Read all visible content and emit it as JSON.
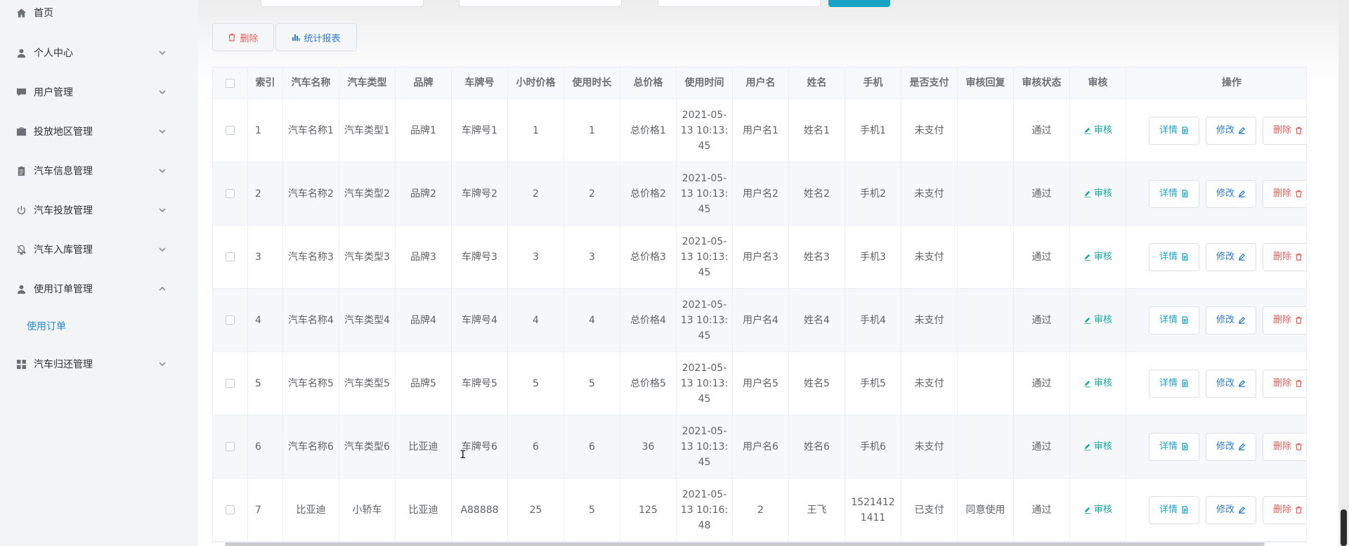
{
  "sidebar": {
    "items": [
      {
        "label": "首页",
        "icon": "home-icon"
      },
      {
        "label": "个人中心",
        "icon": "person-icon"
      },
      {
        "label": "用户管理",
        "icon": "chat-icon"
      },
      {
        "label": "投放地区管理",
        "icon": "briefcase-icon"
      },
      {
        "label": "汽车信息管理",
        "icon": "clipboard-icon"
      },
      {
        "label": "汽车投放管理",
        "icon": "power-icon"
      },
      {
        "label": "汽车入库管理",
        "icon": "bell-off-icon"
      },
      {
        "label": "使用订单管理",
        "icon": "person-icon"
      },
      {
        "label": "汽车归还管理",
        "icon": "grid-icon"
      }
    ],
    "active_sub": "使用订单"
  },
  "toolbar": {
    "delete_label": "删除",
    "report_label": "统计报表"
  },
  "table": {
    "headers": [
      "索引",
      "汽车名称",
      "汽车类型",
      "品牌",
      "车牌号",
      "小时价格",
      "使用时长",
      "总价格",
      "使用时间",
      "用户名",
      "姓名",
      "手机",
      "是否支付",
      "审核回复",
      "审核状态",
      "审核",
      "操作"
    ],
    "rows": [
      [
        "1",
        "汽车名称1",
        "汽车类型1",
        "品牌1",
        "车牌号1",
        "1",
        "1",
        "总价格1",
        "2021-05-13 10:13:45",
        "用户名1",
        "姓名1",
        "手机1",
        "未支付",
        "",
        "通过"
      ],
      [
        "2",
        "汽车名称2",
        "汽车类型2",
        "品牌2",
        "车牌号2",
        "2",
        "2",
        "总价格2",
        "2021-05-13 10:13:45",
        "用户名2",
        "姓名2",
        "手机2",
        "未支付",
        "",
        "通过"
      ],
      [
        "3",
        "汽车名称3",
        "汽车类型3",
        "品牌3",
        "车牌号3",
        "3",
        "3",
        "总价格3",
        "2021-05-13 10:13:45",
        "用户名3",
        "姓名3",
        "手机3",
        "未支付",
        "",
        "通过"
      ],
      [
        "4",
        "汽车名称4",
        "汽车类型4",
        "品牌4",
        "车牌号4",
        "4",
        "4",
        "总价格4",
        "2021-05-13 10:13:45",
        "用户名4",
        "姓名4",
        "手机4",
        "未支付",
        "",
        "通过"
      ],
      [
        "5",
        "汽车名称5",
        "汽车类型5",
        "品牌5",
        "车牌号5",
        "5",
        "5",
        "总价格5",
        "2021-05-13 10:13:45",
        "用户名5",
        "姓名5",
        "手机5",
        "未支付",
        "",
        "通过"
      ],
      [
        "6",
        "汽车名称6",
        "汽车类型6",
        "比亚迪",
        "车牌号6",
        "6",
        "6",
        "36",
        "2021-05-13 10:13:45",
        "用户名6",
        "姓名6",
        "手机6",
        "未支付",
        "",
        "通过"
      ],
      [
        "7",
        "比亚迪",
        "小轿车",
        "比亚迪",
        "A88888",
        "25",
        "5",
        "125",
        "2021-05-13 10:16:48",
        "2",
        "王飞",
        "15214121411",
        "已支付",
        "同意使用",
        "通过"
      ]
    ],
    "audit_label": "审核",
    "detail_label": "详情",
    "edit_label": "修改",
    "delete_label": "删除"
  },
  "colors": {
    "accent": "#1aa3c5",
    "audit": "#14a89c",
    "danger": "#e4605a",
    "edit": "#2b7cd3"
  }
}
